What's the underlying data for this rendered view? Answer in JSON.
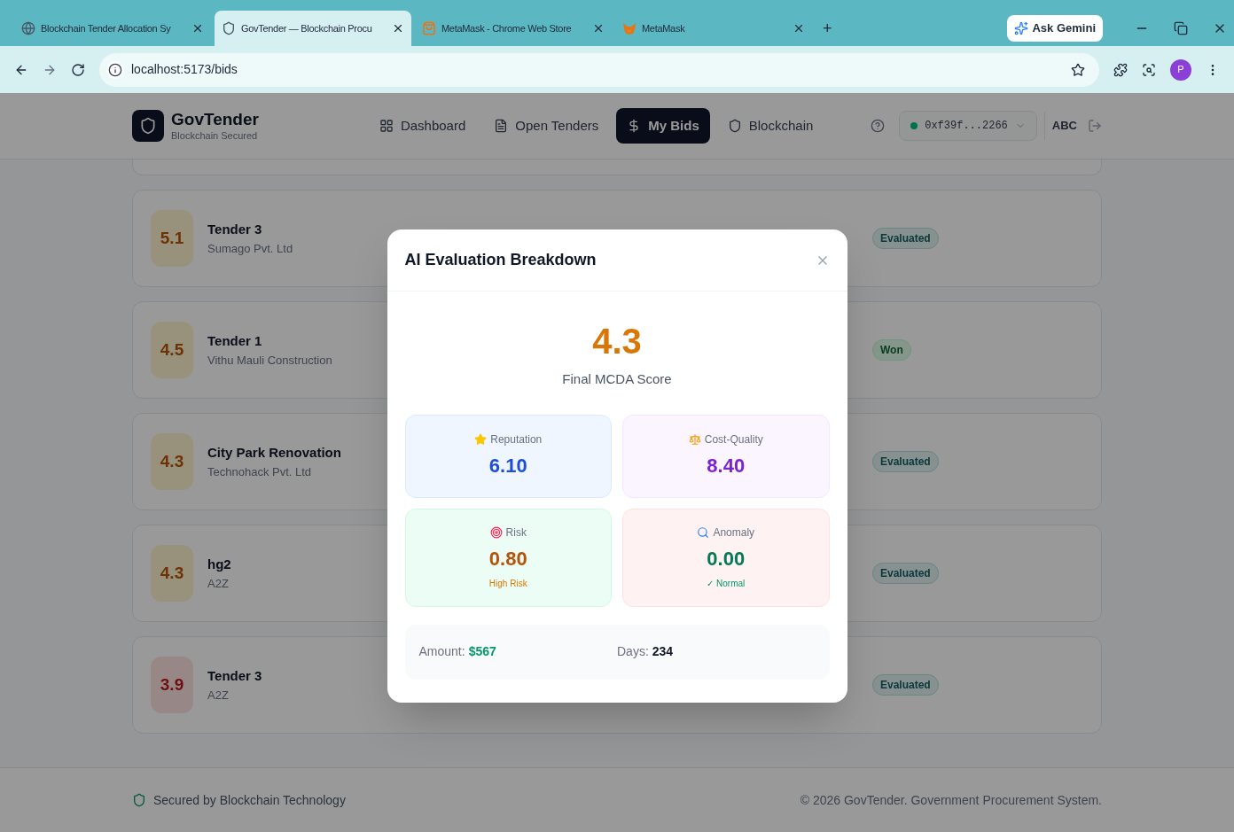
{
  "browser": {
    "tabs": [
      {
        "title": "Blockchain Tender Allocation Sy",
        "selected": false
      },
      {
        "title": "GovTender — Blockchain Procu",
        "selected": true
      },
      {
        "title": "MetaMask - Chrome Web Store",
        "selected": false
      },
      {
        "title": "MetaMask",
        "selected": false
      }
    ],
    "new_tab": "+",
    "gemini": "Ask Gemini",
    "url": "localhost:5173/bids",
    "profile": "P"
  },
  "header": {
    "brand": "GovTender",
    "tagline": "Blockchain Secured",
    "nav": [
      {
        "label": "Dashboard",
        "selected": false
      },
      {
        "label": "Open Tenders",
        "selected": false
      },
      {
        "label": "My Bids",
        "selected": true
      },
      {
        "label": "Blockchain",
        "selected": false
      }
    ],
    "wallet": "0xf39f...2266",
    "user": "ABC"
  },
  "bids": [
    {
      "score": {
        "text": "5.1",
        "kind": "good"
      },
      "title": "Tender 3",
      "company": "Sumago Pvt. Ltd",
      "status": {
        "text": "Evaluated",
        "kind": "evaluated"
      }
    },
    {
      "score": {
        "text": "4.5",
        "kind": "good"
      },
      "title": "Tender 1",
      "company": "Vithu Mauli Construction",
      "status": {
        "text": "Won",
        "kind": "won"
      }
    },
    {
      "score": {
        "text": "4.3",
        "kind": "good"
      },
      "title": "City Park Renovation",
      "company": "Technohack Pvt. Ltd",
      "status": {
        "text": "Evaluated",
        "kind": "evaluated"
      }
    },
    {
      "score": {
        "text": "4.3",
        "kind": "good"
      },
      "title": "hg2",
      "company": "A2Z",
      "status": {
        "text": "Evaluated",
        "kind": "evaluated"
      }
    },
    {
      "score": {
        "text": "3.9",
        "kind": "low"
      },
      "title": "Tender 3",
      "company": "A2Z",
      "status": {
        "text": "Evaluated",
        "kind": "evaluated"
      }
    }
  ],
  "footer": {
    "secured": "Secured by Blockchain Technology",
    "copyright": "© 2026 GovTender. Government Procurement System."
  },
  "modal": {
    "title": "AI Evaluation Breakdown",
    "score": "4.3",
    "score_label": "Final MCDA Score",
    "metrics": [
      {
        "kind": "reputation",
        "label": "Reputation",
        "value": "6.10"
      },
      {
        "kind": "cost_quality",
        "label": "Cost-Quality",
        "value": "8.40"
      },
      {
        "kind": "risk",
        "label": "Risk",
        "value": "0.80",
        "note": "High Risk"
      },
      {
        "kind": "anomaly",
        "label": "Anomaly",
        "value": "0.00",
        "note": "✓ Normal"
      }
    ],
    "summary": [
      {
        "kind": "money",
        "label": "Amount:",
        "value": "$567"
      },
      {
        "kind": "plain",
        "label": "Days:",
        "value": "234"
      }
    ]
  }
}
